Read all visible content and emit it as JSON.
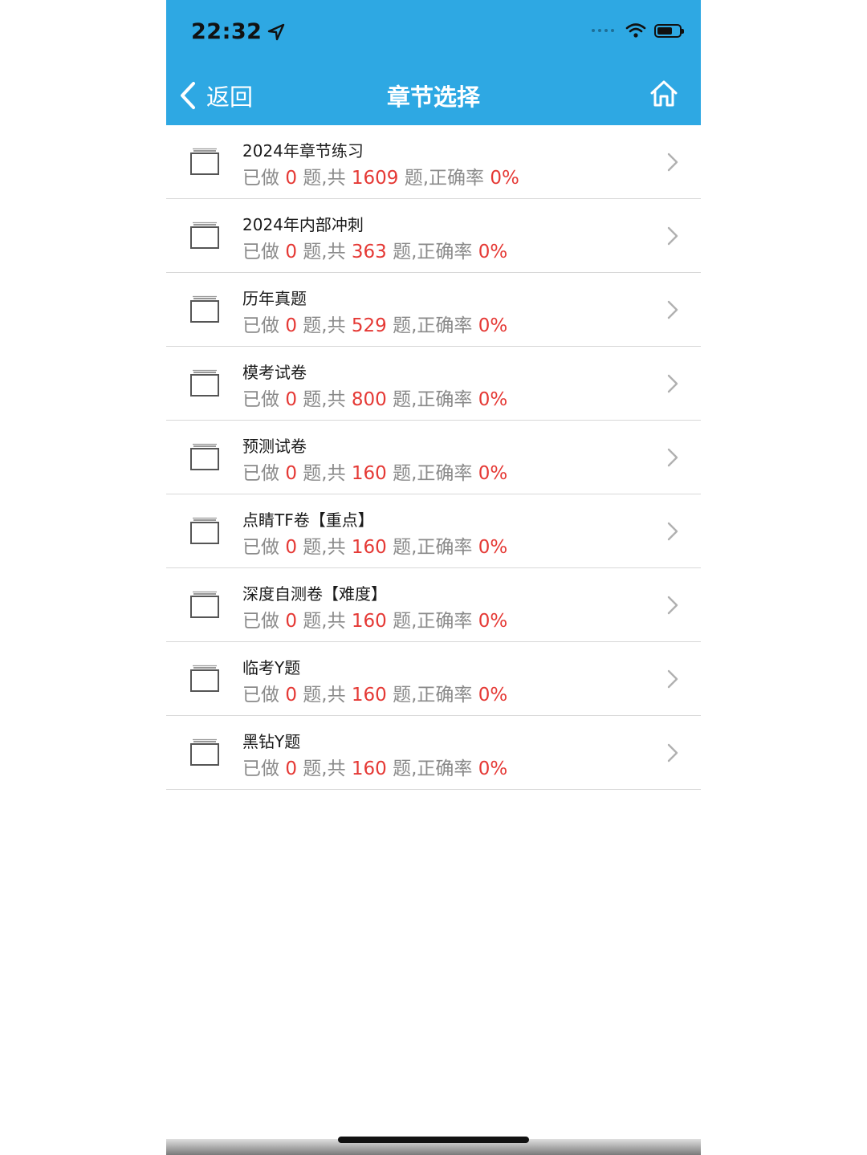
{
  "status_bar": {
    "time": "22:32",
    "icons": [
      "location-arrow-icon",
      "signal-dots-icon",
      "wifi-icon",
      "battery-icon"
    ]
  },
  "nav": {
    "back_label": "返回",
    "title": "章节选择",
    "home_icon": "home-icon"
  },
  "colors": {
    "nav_background": "#2ea8e3",
    "highlight_red": "#e53935",
    "subtitle_gray": "#8a8a8a"
  },
  "items": [
    {
      "title": "2024年章节练习",
      "done": "0",
      "total": "1609",
      "accuracy": "0%"
    },
    {
      "title": "2024年内部冲刺",
      "done": "0",
      "total": "363",
      "accuracy": "0%"
    },
    {
      "title": "历年真题",
      "done": "0",
      "total": "529",
      "accuracy": "0%"
    },
    {
      "title": "模考试卷",
      "done": "0",
      "total": "800",
      "accuracy": "0%"
    },
    {
      "title": "预测试卷",
      "done": "0",
      "total": "160",
      "accuracy": "0%"
    },
    {
      "title": "点睛TF卷【重点】",
      "done": "0",
      "total": "160",
      "accuracy": "0%"
    },
    {
      "title": "深度自测卷【难度】",
      "done": "0",
      "total": "160",
      "accuracy": "0%"
    },
    {
      "title": "临考Y题",
      "done": "0",
      "total": "160",
      "accuracy": "0%"
    },
    {
      "title": "黑钻Y题",
      "done": "0",
      "total": "160",
      "accuracy": "0%"
    }
  ],
  "row_text": {
    "done_prefix": "已做 ",
    "done_suffix": " 题,共 ",
    "total_suffix": " 题,正确率 "
  }
}
